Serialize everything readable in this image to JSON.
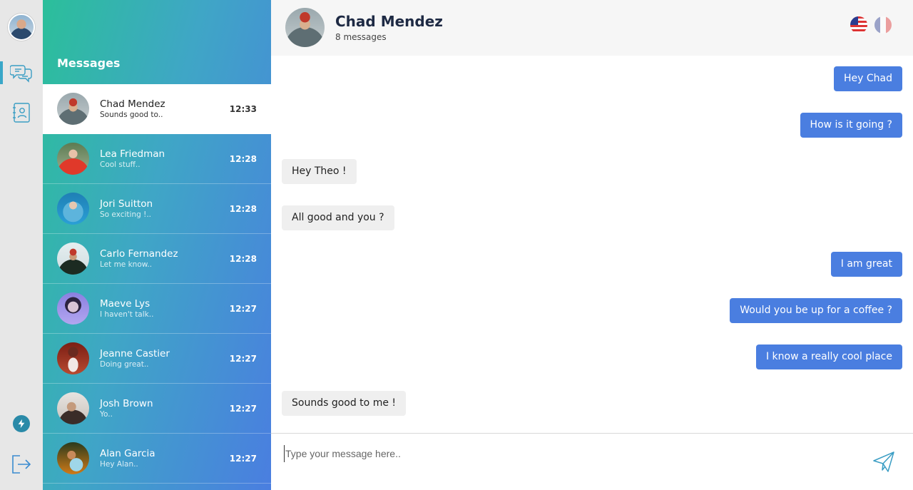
{
  "app": {
    "section_title": "Messages"
  },
  "rail": {
    "icons": [
      "chat-bubbles-icon",
      "contacts-book-icon",
      "lightning-icon",
      "logout-icon"
    ]
  },
  "conversations": [
    {
      "name": "Chad Mendez",
      "preview": "Sounds good to..",
      "time": "12:33",
      "active": true
    },
    {
      "name": "Lea Friedman",
      "preview": "Cool stuff..",
      "time": "12:28"
    },
    {
      "name": "Jori Suitton",
      "preview": "So exciting !..",
      "time": "12:28"
    },
    {
      "name": "Carlo Fernandez",
      "preview": "Let me know..",
      "time": "12:28"
    },
    {
      "name": "Maeve Lys",
      "preview": "I haven't talk..",
      "time": "12:27"
    },
    {
      "name": "Jeanne Castier",
      "preview": "Doing great..",
      "time": "12:27"
    },
    {
      "name": "Josh Brown",
      "preview": "Yo..",
      "time": "12:27"
    },
    {
      "name": "Alan Garcia",
      "preview": "Hey Alan..",
      "time": "12:27"
    }
  ],
  "chat": {
    "contact_name": "Chad Mendez",
    "message_count": "8 messages",
    "languages": [
      "us-flag-icon",
      "fr-flag-icon"
    ],
    "messages": [
      {
        "from": "me",
        "text": "Hey Chad"
      },
      {
        "from": "me",
        "text": "How is it going ?"
      },
      {
        "from": "them",
        "text": "Hey Theo !"
      },
      {
        "from": "them",
        "text": "All good and you ?"
      },
      {
        "from": "me",
        "text": "I am great"
      },
      {
        "from": "me",
        "text": "Would you be up for a coffee ?"
      },
      {
        "from": "me",
        "text": "I know a really cool place"
      },
      {
        "from": "them",
        "text": "Sounds good to me !"
      }
    ]
  },
  "composer": {
    "placeholder": "Type your message here..",
    "value": ""
  },
  "colors": {
    "accent": "#4a7ee0",
    "gradient_start": "#2bbf9a",
    "gradient_end": "#4a7ee0",
    "incoming_bubble": "#efefef"
  }
}
